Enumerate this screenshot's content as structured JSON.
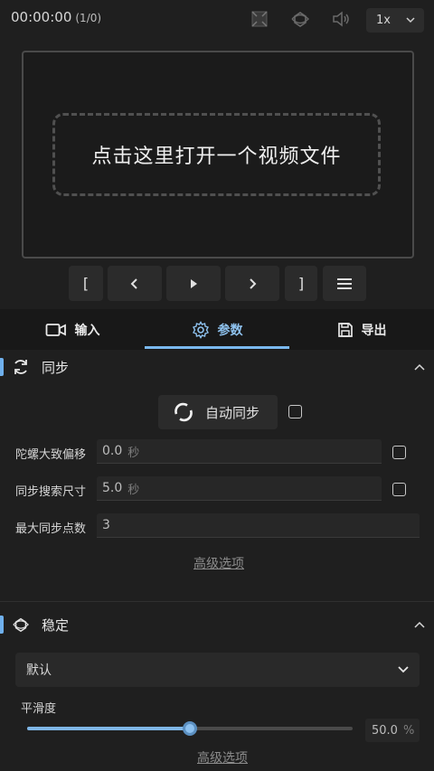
{
  "topbar": {
    "timecode": "00:00:00",
    "frames": "(1/0)",
    "icons": [
      "crop-icon",
      "stabilize-icon",
      "volume-icon"
    ],
    "speed": "1x"
  },
  "video": {
    "drop_text": "点击这里打开一个视频文件"
  },
  "controls": {
    "mark_in": "[",
    "mark_out": "]",
    "icons": [
      "prev-frame-icon",
      "play-icon",
      "next-frame-icon",
      "menu-icon"
    ]
  },
  "tabs": [
    {
      "label": "输入",
      "icon": "camera-icon",
      "active": false
    },
    {
      "label": "参数",
      "icon": "gear-icon",
      "active": true
    },
    {
      "label": "导出",
      "icon": "save-icon",
      "active": false
    }
  ],
  "sync": {
    "title": "同步",
    "auto_sync_label": "自动同步",
    "rows": [
      {
        "label": "陀螺大致偏移",
        "value": "0.0",
        "unit": "秒"
      },
      {
        "label": "同步搜索尺寸",
        "value": "5.0",
        "unit": "秒"
      },
      {
        "label": "最大同步点数",
        "value": "3",
        "unit": ""
      }
    ],
    "advanced_label": "高级选项"
  },
  "stabilization": {
    "title": "稳定",
    "preset": "默认",
    "smoothness_label": "平滑度",
    "smoothness_value": "50.0",
    "smoothness_unit": "%",
    "smoothness_fraction": 0.5,
    "advanced_label": "高级选项"
  },
  "colors": {
    "accent": "#7ab8ee",
    "background": "#1f1f1f"
  }
}
